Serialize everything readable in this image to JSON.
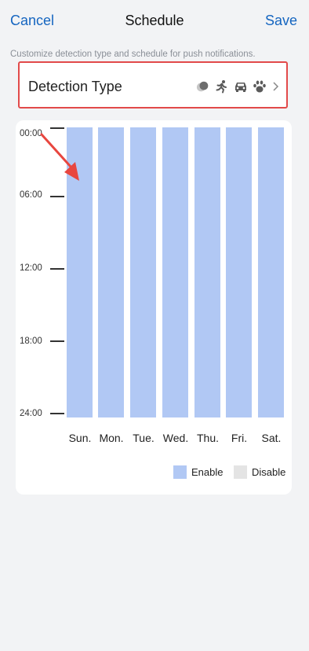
{
  "header": {
    "cancel_label": "Cancel",
    "title": "Schedule",
    "save_label": "Save"
  },
  "description": "Customize detection type and schedule for push notifications.",
  "detection_type": {
    "label": "Detection Type",
    "icons": [
      "motion-icon",
      "person-icon",
      "vehicle-icon",
      "pet-icon"
    ]
  },
  "schedule": {
    "time_labels": [
      "00:00",
      "06:00",
      "12:00",
      "18:00",
      "24:00"
    ],
    "days": [
      "Sun.",
      "Mon.",
      "Tue.",
      "Wed.",
      "Thu.",
      "Fri.",
      "Sat."
    ],
    "legend": {
      "enable_label": "Enable",
      "disable_label": "Disable"
    },
    "colors": {
      "enable": "#b1c8f4",
      "disable": "#e4e4e4"
    }
  },
  "colors": {
    "accent": "#1565c0",
    "highlight_border": "#e24a4a",
    "annotation_arrow": "#e8463f"
  }
}
